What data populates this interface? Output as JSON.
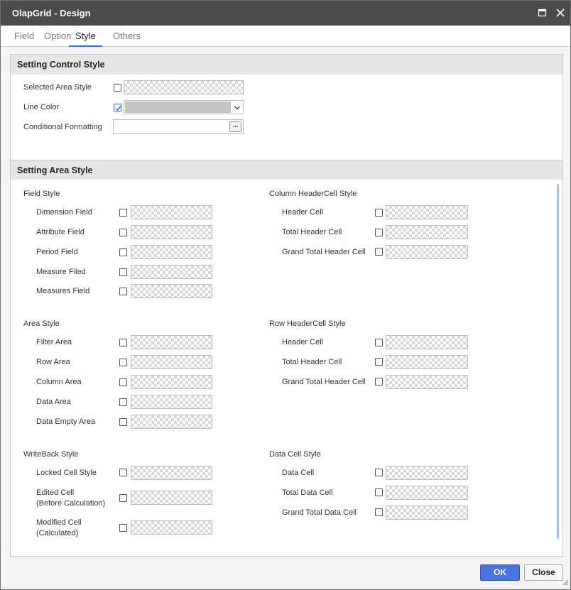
{
  "window": {
    "title": "OlapGrid - Design"
  },
  "tabs": [
    "Field",
    "Option",
    "Style",
    "Others"
  ],
  "active_tab": "Style",
  "control_style": {
    "heading": "Setting Control Style",
    "selected_area_style": "Selected Area Style",
    "line_color": "Line Color",
    "line_color_value": "#c3c3c3",
    "conditional_formatting": "Conditional Formatting",
    "conditional_formatting_button": "..."
  },
  "area_style": {
    "heading": "Setting Area Style",
    "field_style": {
      "title": "Field Style",
      "items": [
        "Dimension Field",
        "Attribute Field",
        "Period Field",
        "Measure Filed",
        "Measures Field"
      ]
    },
    "column_headercell_style": {
      "title": "Column HeaderCell Style",
      "items": [
        "Header Cell",
        "Total Header Cell",
        "Grand Total Header Cell"
      ]
    },
    "area_style": {
      "title": "Area Style",
      "items": [
        "Filter Area",
        "Row Area",
        "Column Area",
        "Data Area",
        "Data Empty Area"
      ]
    },
    "row_headercell_style": {
      "title": "Row HeaderCell Style",
      "items": [
        "Header Cell",
        "Total Header Cell",
        "Grand Total Header Cell"
      ]
    },
    "writeback_style": {
      "title": "WriteBack Style",
      "locked": "Locked Cell Style",
      "edited_1": "Edited Cell",
      "edited_2": "(Before Calculation)",
      "modified_1": "Modified Cell",
      "modified_2": "(Calculated)"
    },
    "data_cell_style": {
      "title": "Data Cell Style",
      "items": [
        "Data Cell",
        "Total Data Cell",
        "Grand Total Data Cell"
      ]
    }
  },
  "footer": {
    "ok": "OK",
    "close": "Close"
  },
  "colors": {
    "titlebar": "#4b4b4b",
    "accent": "#3b6fd4",
    "ok_button": "#4a74e0"
  }
}
